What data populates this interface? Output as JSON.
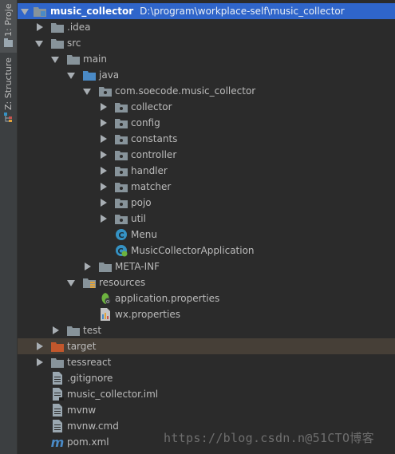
{
  "sidebar": {
    "project_tab": "1: Proje",
    "structure_tab": "Z: Structure"
  },
  "tree": {
    "root": {
      "name": "music_collector",
      "path": "D:\\program\\workplace-self\\music_collector"
    },
    "idea": ".idea",
    "src": "src",
    "main": "main",
    "java": "java",
    "package": "com.soecode.music_collector",
    "packages": [
      "collector",
      "config",
      "constants",
      "controller",
      "handler",
      "matcher",
      "pojo",
      "util"
    ],
    "menu_class": "Menu",
    "app_class": "MusicCollectorApplication",
    "meta_inf": "META-INF",
    "resources": "resources",
    "app_properties": "application.properties",
    "wx_properties": "wx.properties",
    "test": "test",
    "target": "target",
    "tessreact": "tessreact",
    "gitignore": ".gitignore",
    "iml": "music_collector.iml",
    "mvnw": "mvnw",
    "mvnw_cmd": "mvnw.cmd",
    "pom": "pom.xml"
  },
  "watermark": "https://blog.csdn.n@51CTO博客",
  "colors": {
    "selection": "#2f65ca",
    "highlight_row": "#463f37",
    "folder": "#87939a",
    "source_folder": "#4a8ac6",
    "excluded_folder": "#c2572c",
    "class_icon": "#3592c4",
    "spring_green": "#6db33f"
  },
  "icons": {
    "expand": "chevron-down-icon",
    "collapse": "chevron-right-icon",
    "folder": "folder-icon",
    "package": "package-icon",
    "class": "class-icon",
    "spring_class": "spring-boot-class-icon",
    "properties": "properties-file-icon",
    "file": "text-file-icon",
    "maven": "maven-icon"
  }
}
